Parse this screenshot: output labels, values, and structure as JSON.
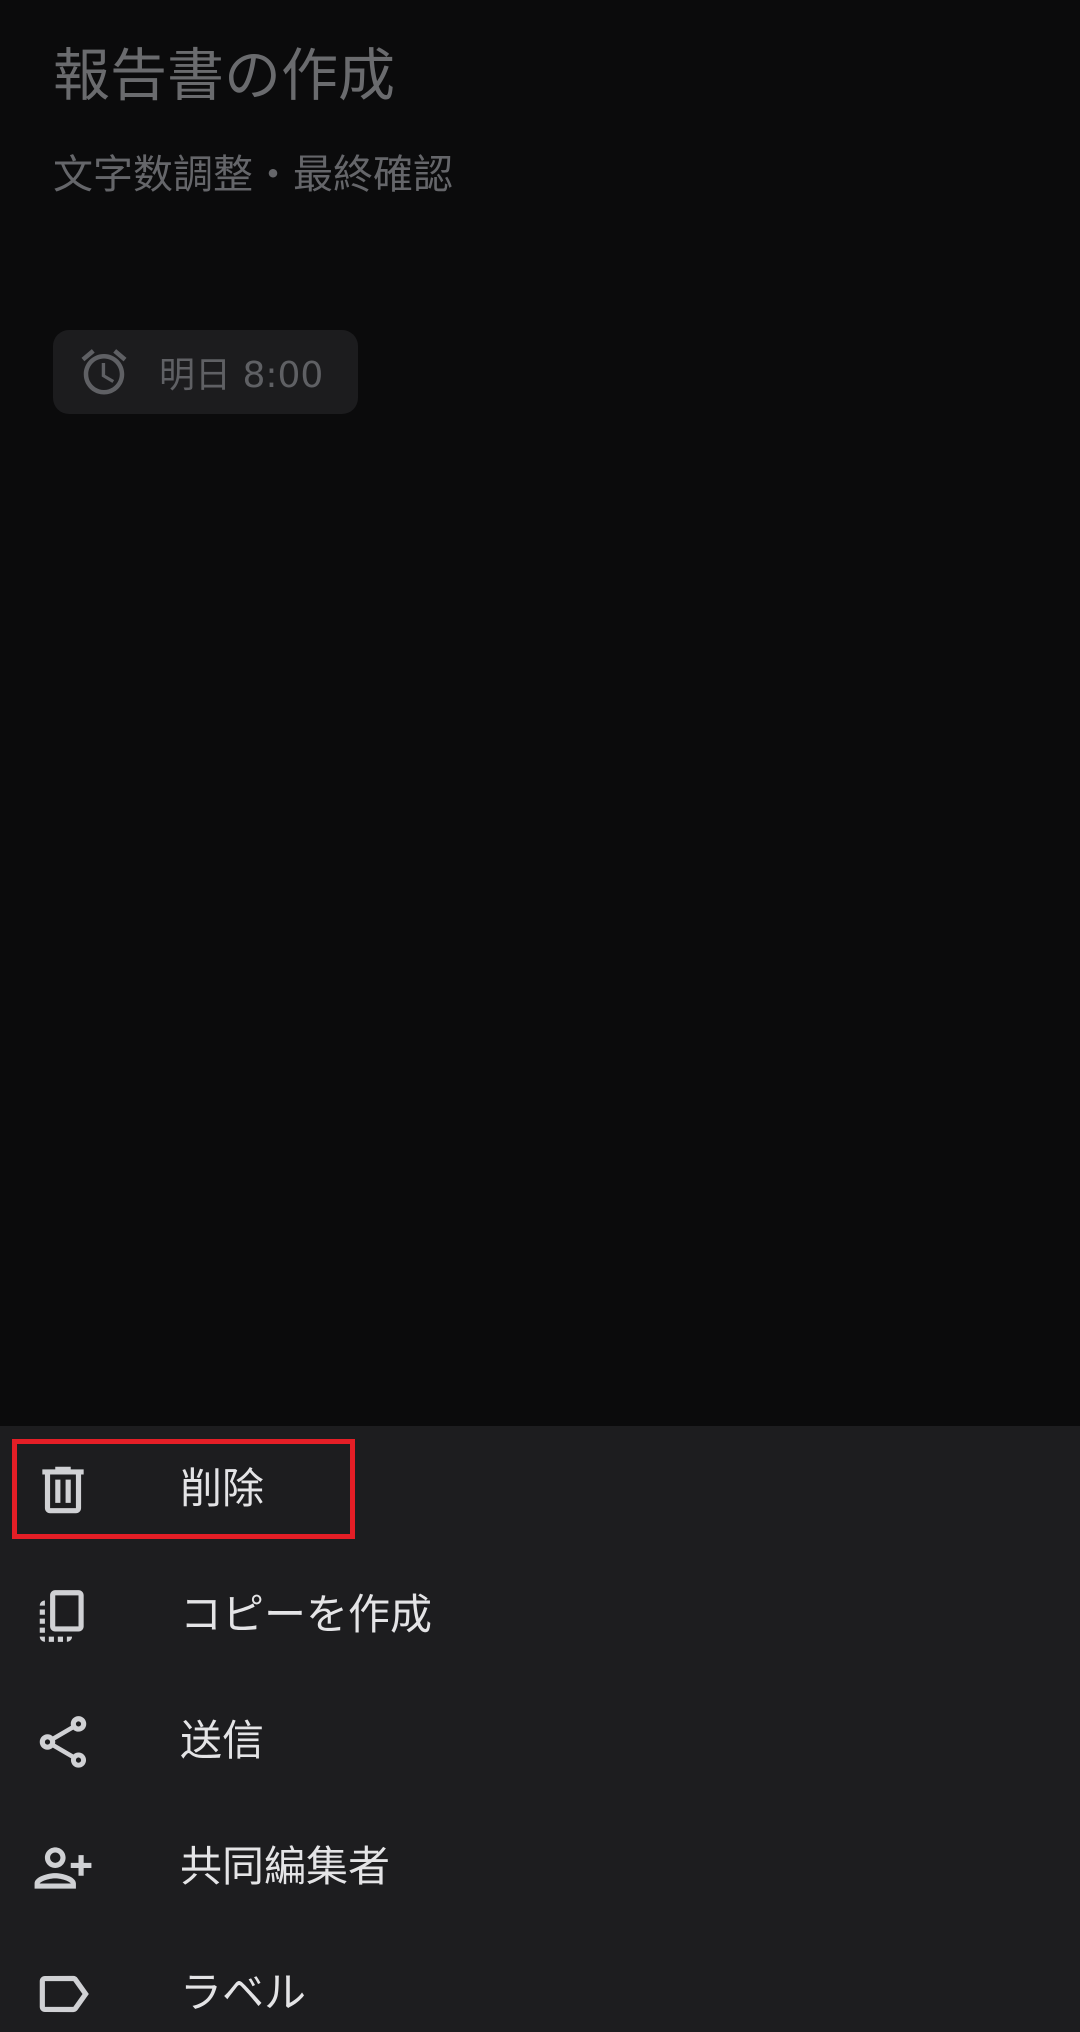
{
  "note": {
    "title": "報告書の作成",
    "body": "文字数調整・最終確認",
    "reminder": {
      "icon": "alarm-icon",
      "label": "明日 8:00"
    }
  },
  "menu": {
    "items": [
      {
        "id": "delete",
        "icon": "trash-icon",
        "label": "削除",
        "highlighted": true
      },
      {
        "id": "copy",
        "icon": "copy-icon",
        "label": "コピーを作成"
      },
      {
        "id": "send",
        "icon": "share-icon",
        "label": "送信"
      },
      {
        "id": "collaborators",
        "icon": "add-person-icon",
        "label": "共同編集者"
      },
      {
        "id": "label",
        "icon": "label-icon",
        "label": "ラベル"
      }
    ]
  },
  "colors": {
    "background": "#0b0b0c",
    "sheet": "#1d1d1f",
    "highlight": "#e41e26",
    "menu_text": "#e4e4e6"
  }
}
